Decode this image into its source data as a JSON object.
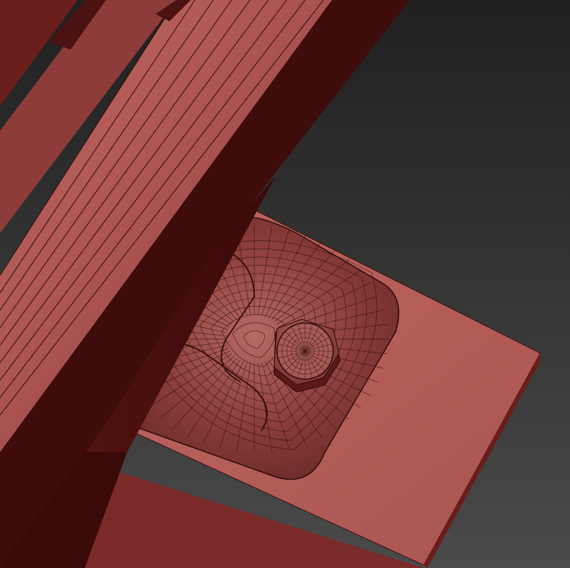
{
  "viewport": {
    "background_top": "#202020",
    "background_bottom": "#4a4a4a"
  },
  "materials": {
    "wood_light": "#b05a58",
    "wood_mid": "#8e3c3a",
    "wood_dark": "#4a1210",
    "wood_shadow": "#2e0806",
    "wire_color": "#2a0a08"
  },
  "objects": [
    {
      "name": "rail-beam",
      "type": "wooden-beam"
    },
    {
      "name": "post-block",
      "type": "wooden-block"
    },
    {
      "name": "base-plate",
      "type": "wooden-plate"
    },
    {
      "name": "recessed-pocket",
      "type": "sculpted-mesh"
    },
    {
      "name": "hex-bolt",
      "type": "bolt"
    }
  ]
}
